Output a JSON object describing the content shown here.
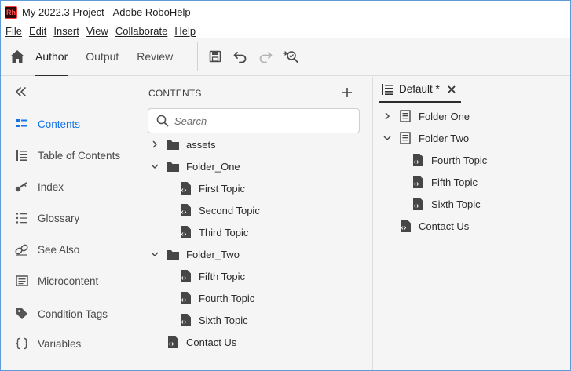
{
  "window": {
    "title": "My 2022.3 Project - Adobe RoboHelp",
    "app_logo": "Rh"
  },
  "menu": [
    "File",
    "Edit",
    "Insert",
    "View",
    "Collaborate",
    "Help"
  ],
  "toolbar": {
    "tabs": [
      {
        "label": "Author",
        "active": true
      },
      {
        "label": "Output",
        "active": false
      },
      {
        "label": "Review",
        "active": false
      }
    ],
    "buttons": [
      "save-icon",
      "undo-icon",
      "redo-icon",
      "find-replace-icon"
    ]
  },
  "leftnav": {
    "items": [
      {
        "label": "Contents",
        "icon": "contents-icon",
        "active": true
      },
      {
        "label": "Table of Contents",
        "icon": "toc-icon",
        "active": false
      },
      {
        "label": "Index",
        "icon": "key-icon",
        "active": false
      },
      {
        "label": "Glossary",
        "icon": "glossary-icon",
        "active": false
      },
      {
        "label": "See Also",
        "icon": "link-icon",
        "active": false
      },
      {
        "label": "Microcontent",
        "icon": "microcontent-icon",
        "active": false
      },
      {
        "label": "Condition Tags",
        "icon": "tag-icon",
        "active": false
      },
      {
        "label": "Variables",
        "icon": "braces-icon",
        "active": false
      }
    ]
  },
  "contents": {
    "header": "CONTENTS",
    "search_placeholder": "Search",
    "tree": [
      {
        "label": "assets",
        "type": "folder",
        "state": "collapsed"
      },
      {
        "label": "Folder_One",
        "type": "folder",
        "state": "expanded"
      },
      {
        "label": "First Topic",
        "type": "topic"
      },
      {
        "label": "Second Topic",
        "type": "topic"
      },
      {
        "label": "Third Topic",
        "type": "topic"
      },
      {
        "label": "Folder_Two",
        "type": "folder",
        "state": "expanded"
      },
      {
        "label": "Fifth Topic",
        "type": "topic"
      },
      {
        "label": "Fourth Topic",
        "type": "topic"
      },
      {
        "label": "Sixth Topic",
        "type": "topic"
      },
      {
        "label": "Contact Us",
        "type": "topic"
      }
    ]
  },
  "toc_panel": {
    "tab_label": "Default *",
    "tree": [
      {
        "label": "Folder One",
        "type": "book",
        "state": "collapsed"
      },
      {
        "label": "Folder Two",
        "type": "book",
        "state": "expanded"
      },
      {
        "label": "Fourth Topic",
        "type": "topic"
      },
      {
        "label": "Fifth Topic",
        "type": "topic"
      },
      {
        "label": "Sixth Topic",
        "type": "topic"
      },
      {
        "label": "Contact Us",
        "type": "topic"
      }
    ]
  },
  "colors": {
    "accent": "#1473e6",
    "text": "#2c2c2c",
    "panel_bg": "#f5f5f5",
    "window_border": "#5f9bd6"
  }
}
